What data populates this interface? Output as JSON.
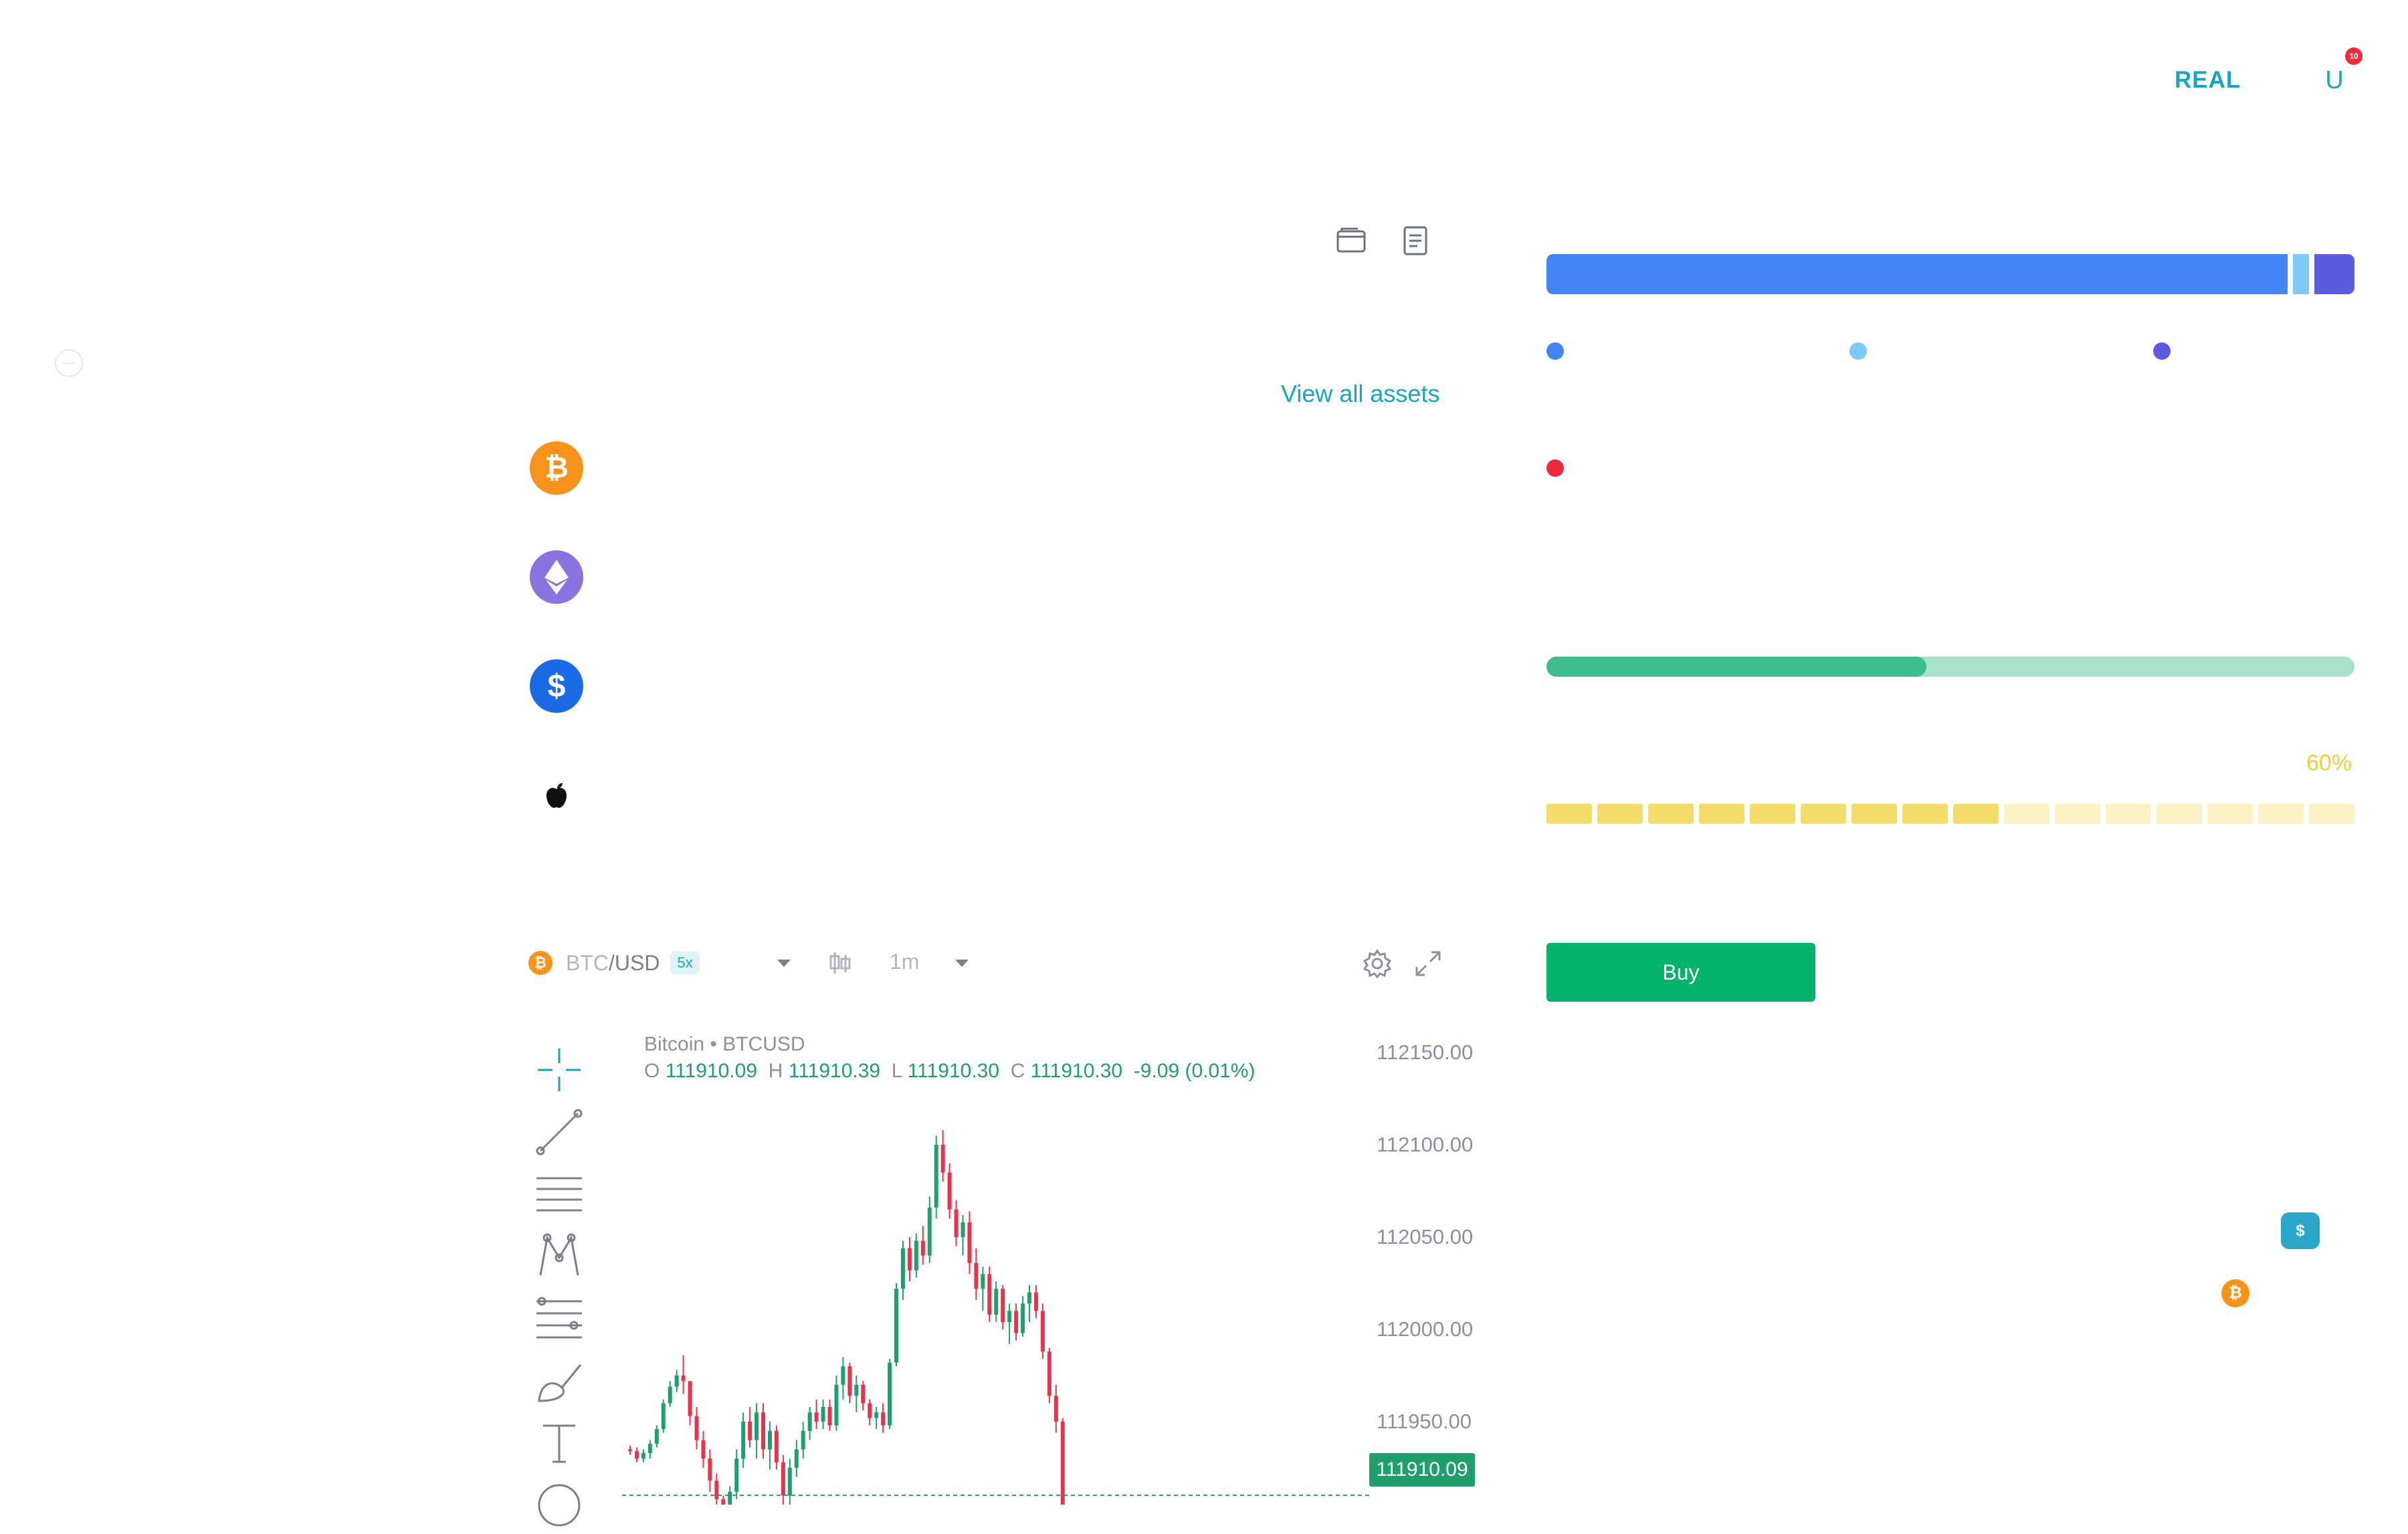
{
  "topbar": {
    "account_mode": "REAL",
    "avatar_letter": "U",
    "notification_count": "10"
  },
  "portfolio": {
    "view_all_label": "View all assets"
  },
  "assets": [
    {
      "icon": "bitcoin-icon",
      "color": "#f7931a",
      "glyph": "₿"
    },
    {
      "icon": "ethereum-icon",
      "color": "#8a72e0",
      "glyph": "◆"
    },
    {
      "icon": "usd-coin-icon",
      "color": "#1a6ae6",
      "glyph": "$"
    },
    {
      "icon": "apple-icon",
      "color": "#111111",
      "glyph": ""
    }
  ],
  "allocation": {
    "segments": [
      {
        "color": "#4285f4",
        "share": 0.925
      },
      {
        "color": "#7dc9f7",
        "share": 0.02
      },
      {
        "color": "#5b5ce0",
        "share": 0.05
      }
    ],
    "legend_colors": [
      "#4285f4",
      "#7dc9f7",
      "#5b5ce0",
      "#ef2b3a"
    ]
  },
  "progress": {
    "fraction": 0.47
  },
  "risk_meter": {
    "label": "60%",
    "segments_total": 16,
    "segments_filled": 9,
    "filled_color": "#f4dc6a",
    "empty_color": "#fbf1c4"
  },
  "trade": {
    "buy_label": "Buy"
  },
  "floating": {
    "usd_label": "$",
    "btc_label": "₿"
  },
  "chart_toolbar": {
    "base": "BTC",
    "quote": "/USD",
    "leverage": "5x",
    "interval": "1m"
  },
  "chart": {
    "title": "Bitcoin • BTCUSD",
    "ohlc": {
      "o_label": "O",
      "o": "111910.09",
      "h_label": "H",
      "h": "111910.39",
      "l_label": "L",
      "l": "111910.30",
      "c_label": "C",
      "c": "111910.30",
      "change": "-9.09 (0.01%)"
    },
    "price_ticks": [
      "112150.00",
      "112100.00",
      "112050.00",
      "112000.00",
      "111950.00"
    ],
    "last_price": "111910.09"
  },
  "chart_data": {
    "type": "candlestick",
    "title": "Bitcoin • BTCUSD",
    "ylim": [
      111895,
      112160
    ],
    "y_ticks": [
      112150,
      112100,
      112050,
      112000,
      111950
    ],
    "last_price": 111910.09,
    "up_color": "#1e9f6c",
    "down_color": "#e8344a",
    "candles": [
      [
        111935,
        111937,
        111932,
        111934
      ],
      [
        111934,
        111936,
        111928,
        111930
      ],
      [
        111930,
        111935,
        111928,
        111933
      ],
      [
        111933,
        111940,
        111930,
        111938
      ],
      [
        111938,
        111948,
        111936,
        111946
      ],
      [
        111946,
        111962,
        111944,
        111960
      ],
      [
        111960,
        111972,
        111958,
        111969
      ],
      [
        111969,
        111978,
        111966,
        111975
      ],
      [
        111975,
        111986,
        111965,
        111972
      ],
      [
        111972,
        111972,
        111948,
        111953
      ],
      [
        111953,
        111958,
        111935,
        111940
      ],
      [
        111940,
        111945,
        111925,
        111930
      ],
      [
        111930,
        111935,
        111912,
        111918
      ],
      [
        111918,
        111922,
        111902,
        111908
      ],
      [
        111908,
        111910,
        111898,
        111905
      ],
      [
        111905,
        111915,
        111895,
        111912
      ],
      [
        111912,
        111935,
        111908,
        111930
      ],
      [
        111930,
        111955,
        111925,
        111950
      ],
      [
        111950,
        111958,
        111936,
        111940
      ],
      [
        111940,
        111960,
        111930,
        111955
      ],
      [
        111955,
        111960,
        111930,
        111935
      ],
      [
        111935,
        111950,
        111924,
        111945
      ],
      [
        111945,
        111948,
        111924,
        111928
      ],
      [
        111928,
        111932,
        111905,
        111910
      ],
      [
        111910,
        111930,
        111905,
        111925
      ],
      [
        111925,
        111940,
        111920,
        111935
      ],
      [
        111935,
        111950,
        111930,
        111945
      ],
      [
        111945,
        111958,
        111940,
        111955
      ],
      [
        111955,
        111962,
        111946,
        111950
      ],
      [
        111950,
        111962,
        111946,
        111958
      ],
      [
        111958,
        111962,
        111945,
        111948
      ],
      [
        111948,
        111975,
        111945,
        111970
      ],
      [
        111970,
        111985,
        111962,
        111980
      ],
      [
        111980,
        111982,
        111960,
        111964
      ],
      [
        111964,
        111975,
        111955,
        111970
      ],
      [
        111970,
        111972,
        111956,
        111960
      ],
      [
        111960,
        111962,
        111948,
        111952
      ],
      [
        111952,
        111958,
        111946,
        111955
      ],
      [
        111955,
        111960,
        111944,
        111948
      ],
      [
        111948,
        111984,
        111946,
        111982
      ],
      [
        111982,
        112025,
        111980,
        112022
      ],
      [
        112022,
        112048,
        112016,
        112044
      ],
      [
        112044,
        112050,
        112026,
        112032
      ],
      [
        112032,
        112052,
        112028,
        112048
      ],
      [
        112048,
        112056,
        112035,
        112040
      ],
      [
        112040,
        112072,
        112036,
        112066
      ],
      [
        112066,
        112105,
        112060,
        112100
      ],
      [
        112100,
        112108,
        112080,
        112085
      ],
      [
        112085,
        112090,
        112060,
        112065
      ],
      [
        112065,
        112070,
        112045,
        112050
      ],
      [
        112050,
        112062,
        112040,
        112058
      ],
      [
        112058,
        112064,
        112030,
        112036
      ],
      [
        112036,
        112044,
        112016,
        112022
      ],
      [
        112022,
        112034,
        112010,
        112030
      ],
      [
        112030,
        112034,
        112004,
        112008
      ],
      [
        112008,
        112026,
        112004,
        112022
      ],
      [
        112022,
        112024,
        112000,
        112004
      ],
      [
        112004,
        112014,
        111992,
        112010
      ],
      [
        112010,
        112014,
        111994,
        111998
      ],
      [
        111998,
        112018,
        111996,
        112014
      ],
      [
        112014,
        112024,
        112004,
        112020
      ],
      [
        112020,
        112024,
        112006,
        112010
      ],
      [
        112010,
        112014,
        111984,
        111988
      ],
      [
        111988,
        111990,
        111960,
        111964
      ],
      [
        111964,
        111970,
        111944,
        111950
      ],
      [
        111950,
        111952,
        111900,
        111905
      ]
    ]
  }
}
